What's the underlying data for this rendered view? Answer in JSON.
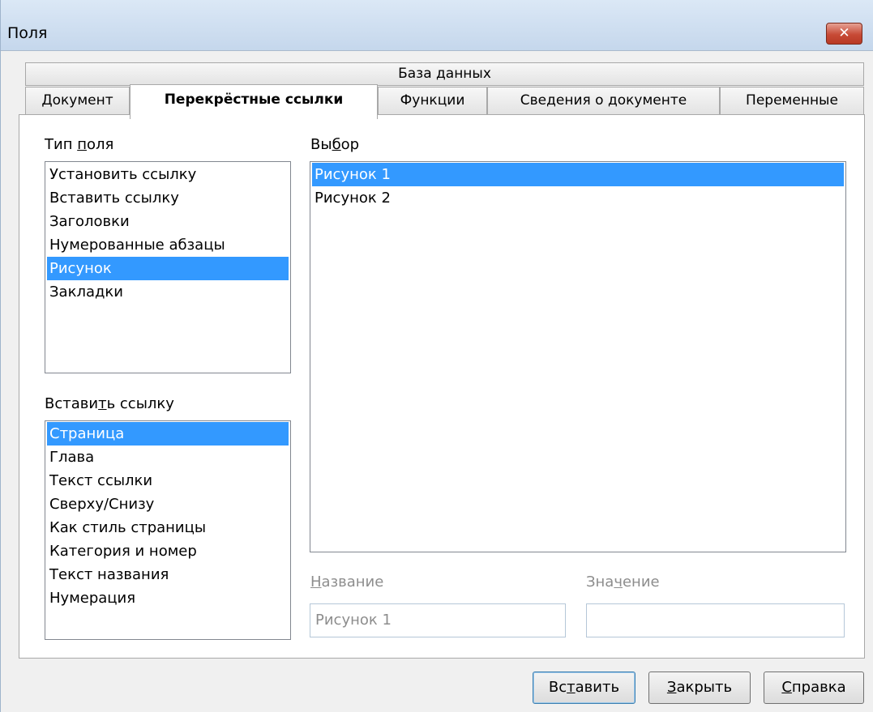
{
  "window": {
    "title": "Поля",
    "close_glyph": "✕"
  },
  "tabs": {
    "row1": "База данных",
    "row2": [
      {
        "label": "Документ"
      },
      {
        "label": "Перекрёстные ссылки",
        "active": true
      },
      {
        "label": "Функции"
      },
      {
        "label": "Сведения о документе"
      },
      {
        "label": "Переменные"
      }
    ]
  },
  "field_type": {
    "label_pre": "Тип ",
    "label_accel": "п",
    "label_post": "оля",
    "items": [
      "Установить ссылку",
      "Вставить ссылку",
      "Заголовки",
      "Нумерованные абзацы",
      "Рисунок",
      "Закладки"
    ],
    "selected": "Рисунок"
  },
  "selection": {
    "label_pre": "Вы",
    "label_accel": "б",
    "label_post": "ор",
    "items": [
      "Рисунок 1",
      "Рисунок 2"
    ],
    "selected": "Рисунок 1"
  },
  "insert_reference": {
    "label_pre": "Встави",
    "label_accel": "т",
    "label_post": "ь ссылку",
    "items": [
      "Страница",
      "Глава",
      "Текст ссылки",
      "Сверху/Снизу",
      "Как стиль страницы",
      "Категория и номер",
      "Текст названия",
      "Нумерация"
    ],
    "selected": "Страница"
  },
  "name_field": {
    "label_pre": "",
    "label_accel": "Н",
    "label_post": "азвание",
    "value": "Рисунок 1"
  },
  "value_field": {
    "label_pre": "Зна",
    "label_accel": "ч",
    "label_post": "ение",
    "value": ""
  },
  "buttons": {
    "insert": {
      "pre": "Вс",
      "accel": "т",
      "post": "авить"
    },
    "close": {
      "pre": "",
      "accel": "З",
      "post": "акрыть"
    },
    "help": {
      "pre": "",
      "accel": "С",
      "post": "правка"
    }
  }
}
